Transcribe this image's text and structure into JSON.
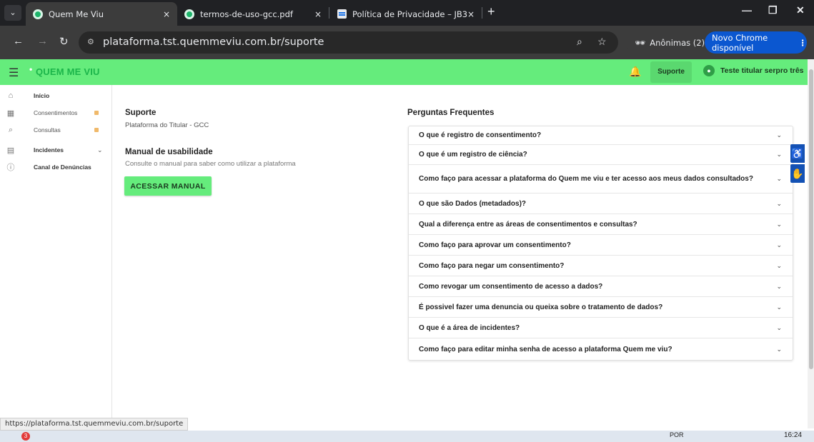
{
  "browser": {
    "tabs": [
      {
        "title": "Quem Me Viu",
        "active": true
      },
      {
        "title": "termos-de-uso-gcc.pdf",
        "active": false
      },
      {
        "title": "Política de Privacidade – JB3",
        "active": false
      }
    ],
    "close_glyph": "×",
    "newtab_glyph": "+",
    "url": "plataforma.tst.quemmeviu.com.br/suporte",
    "incognito_label": "Anônimas (2)",
    "update_label": "Novo Chrome disponível"
  },
  "app": {
    "brand": "QUEM ME VIU",
    "header_link": "Suporte",
    "user_name": "Teste titular serpro três",
    "colors": {
      "accent": "#65ec7c",
      "brand_text": "#1bb54a",
      "lock": "#f0b96a",
      "a11y": "#1351b4"
    }
  },
  "sidebar": {
    "items": [
      {
        "label": "Início",
        "icon": "home-icon"
      },
      {
        "label": "Consentimentos",
        "icon": "grid-icon"
      },
      {
        "label": "Consultas",
        "icon": "search-icon"
      },
      {
        "label": "Incidentes",
        "icon": "incident-icon"
      },
      {
        "label": "Canal de Denúncias",
        "icon": "alert-icon"
      }
    ]
  },
  "support": {
    "title": "Suporte",
    "subtitle": "Plataforma do Titular - GCC",
    "manual_title": "Manual de usabilidade",
    "manual_desc": "Consulte o manual para saber como utilizar a plataforma",
    "manual_button": "ACESSAR MANUAL"
  },
  "faq": {
    "title": "Perguntas Frequentes",
    "items": [
      "O que é registro de consentimento?",
      "O que é um registro de ciência?",
      "Como faço para acessar a plataforma do Quem me viu e ter acesso aos meus dados consultados?",
      "O que são Dados (metadados)?",
      "Qual a diferença entre as áreas de consentimentos e consultas?",
      "Como faço para aprovar um consentimento?",
      "Como faço para negar um consentimento?",
      "Como revogar um consentimento de acesso a dados?",
      "É possivel fazer uma denuncia ou queixa sobre o tratamento de dados?",
      "O que é a área de incidentes?",
      "Como faço para editar minha senha de acesso a plataforma Quem me viu?"
    ]
  },
  "status_link": "https://plataforma.tst.quemmeviu.com.br/suporte",
  "taskbar": {
    "badge": "3",
    "lang": "POR",
    "time": "16:24"
  }
}
